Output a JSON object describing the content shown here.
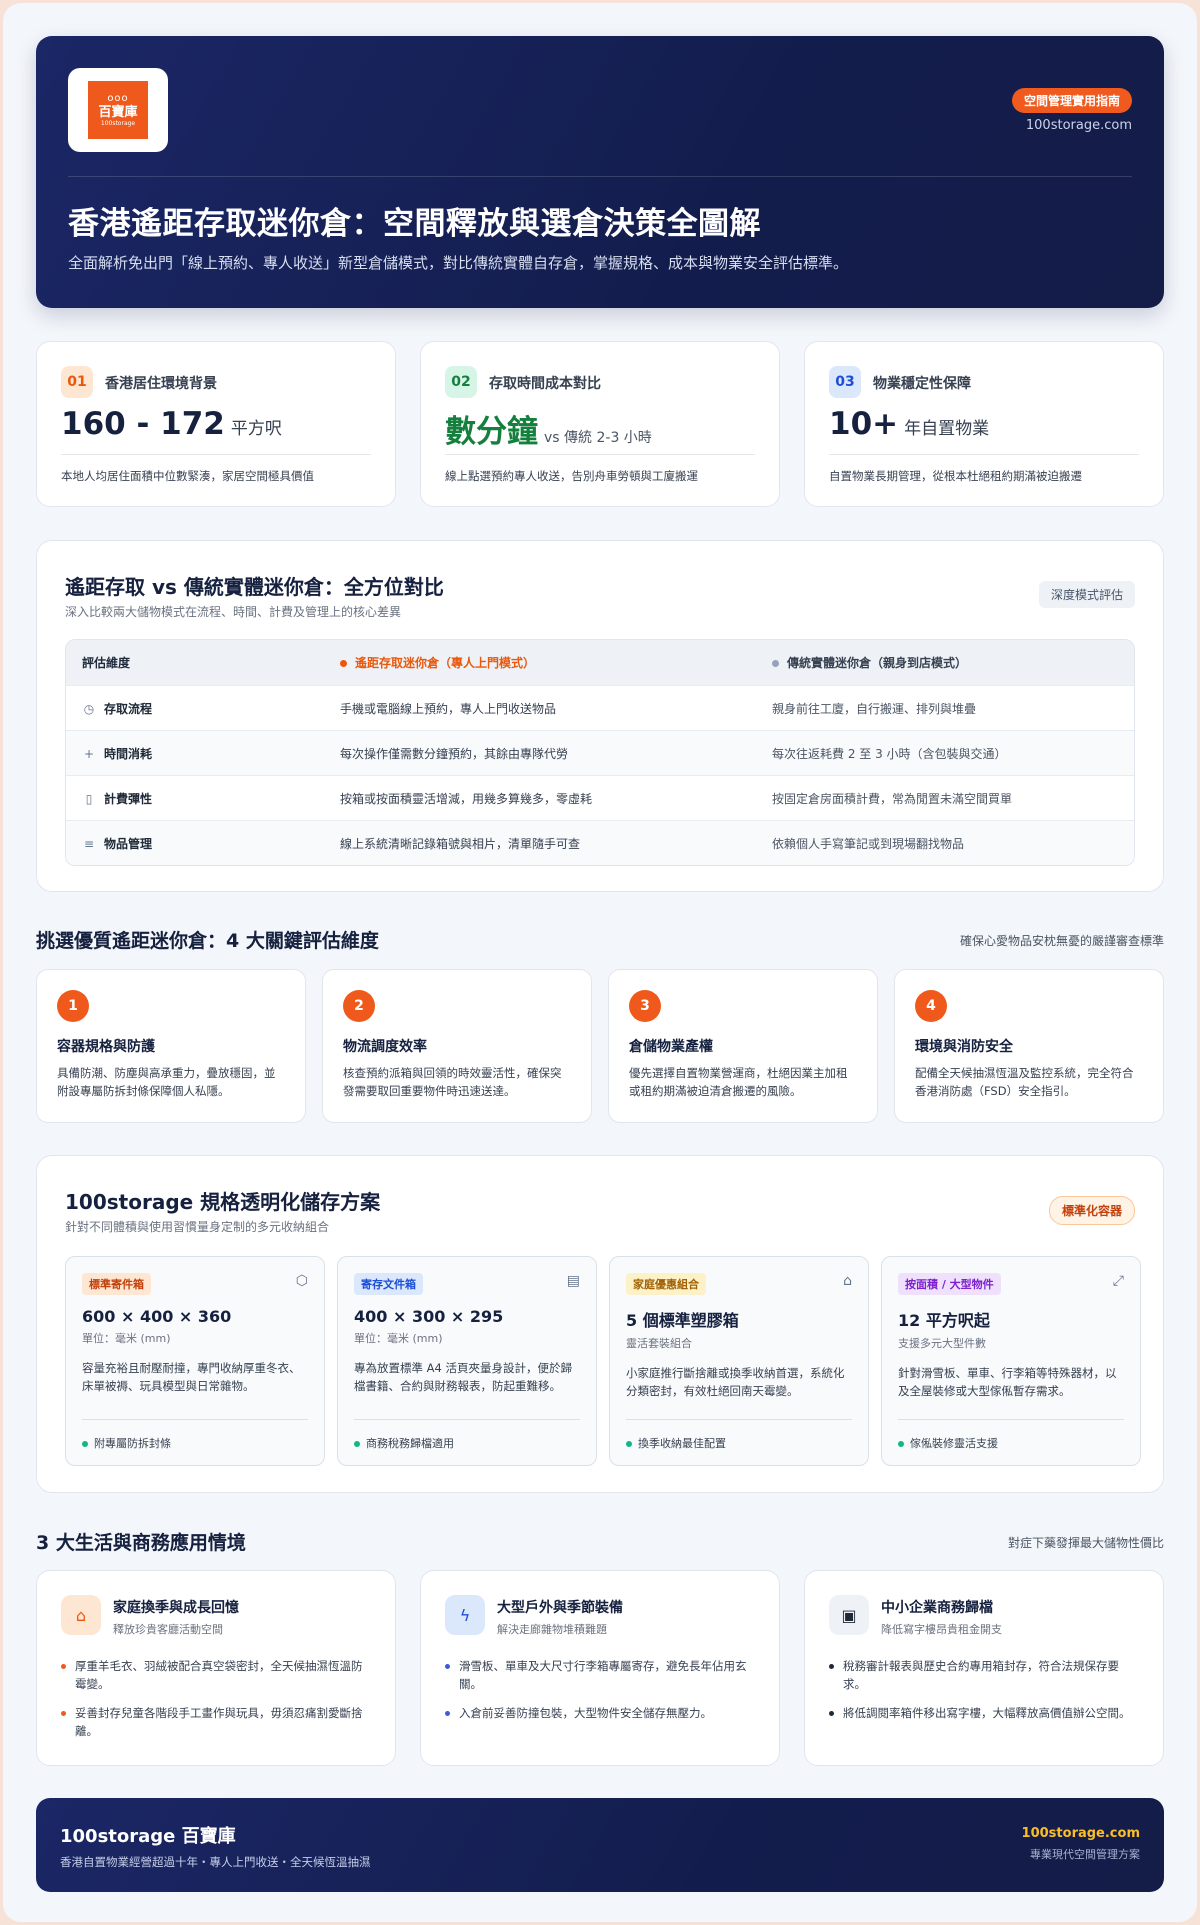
{
  "hero": {
    "logo": {
      "cn": "百寶庫",
      "en": "100storage",
      "dots": "ooo"
    },
    "badge": "空間管理實用指南",
    "site": "100storage.com",
    "title": "香港遙距存取迷你倉：空間釋放與選倉決策全圖解",
    "subtitle": "全面解析免出門「線上預約、專人收送」新型倉儲模式，對比傳統實體自存倉，掌握規格、成本與物業安全評估標準。"
  },
  "stats": [
    {
      "num": "01",
      "label": "香港居住環境背景",
      "value": "160 - 172",
      "unit": "平方呎",
      "note": "本地人均居住面積中位數緊湊，家居空間極具價值"
    },
    {
      "num": "02",
      "label": "存取時間成本對比",
      "value": "數分鐘",
      "unit": "vs 傳統 2-3 小時",
      "note": "線上點選預約專人收送，告別舟車勞頓與工廈搬運"
    },
    {
      "num": "03",
      "label": "物業穩定性保障",
      "value": "10+",
      "unit": "年自置物業",
      "note": "自置物業長期管理，從根本杜絕租約期滿被迫搬遷"
    }
  ],
  "compare": {
    "title": "遙距存取 vs 傳統實體迷你倉：全方位對比",
    "subtitle": "深入比較兩大儲物模式在流程、時間、計費及管理上的核心差異",
    "tag": "深度模式評估",
    "headers": [
      "評估維度",
      "遙距存取迷你倉（專人上門模式）",
      "傳統實體迷你倉（親身到店模式）"
    ],
    "rows": [
      {
        "icon": "clock-icon",
        "glyph": "◷",
        "dim": "存取流程",
        "remote": "手機或電腦線上預約，專人上門收送物品",
        "trad": "親身前往工廈，自行搬運、排列與堆疊"
      },
      {
        "icon": "plus-icon",
        "glyph": "+",
        "dim": "時間消耗",
        "remote": "每次操作僅需數分鐘預約，其餘由專隊代勞",
        "trad": "每次往返耗費 2 至 3 小時（含包裝與交通）"
      },
      {
        "icon": "calculator-icon",
        "glyph": "▯",
        "dim": "計費彈性",
        "remote": "按箱或按面積靈活增減，用幾多算幾多，零虛耗",
        "trad": "按固定倉房面積計費，常為閒置未滿空間買單"
      },
      {
        "icon": "list-icon",
        "glyph": "≡",
        "dim": "物品管理",
        "remote": "線上系統清晰記錄箱號與相片，清單隨手可查",
        "trad": "依賴個人手寫筆記或到現場翻找物品"
      }
    ]
  },
  "evalSection": {
    "title": "挑選優質遙距迷你倉：4 大關鍵評估維度",
    "right": "確保心愛物品安枕無憂的嚴謹審查標準",
    "items": [
      {
        "n": "1",
        "title": "容器規格與防護",
        "desc": "具備防潮、防塵與高承重力，疊放穩固，並附設專屬防拆封條保障個人私隱。"
      },
      {
        "n": "2",
        "title": "物流調度效率",
        "desc": "核查預約派箱與回領的時效靈活性，確保突發需要取回重要物件時迅速送達。"
      },
      {
        "n": "3",
        "title": "倉儲物業產權",
        "desc": "優先選擇自置物業營運商，杜絕因業主加租或租約期滿被迫清倉搬遷的風險。"
      },
      {
        "n": "4",
        "title": "環境與消防安全",
        "desc": "配備全天候抽濕恆溫及監控系統，完全符合香港消防處（FSD）安全指引。"
      }
    ]
  },
  "plans": {
    "title": "100storage 規格透明化儲存方案",
    "subtitle": "針對不同體積與使用習慣量身定制的多元收納組合",
    "tag": "標準化容器",
    "items": [
      {
        "tag": "標準寄件箱",
        "tagBg": "#fde7d3",
        "tagColor": "#c2410c",
        "icon": "box-icon",
        "glyph": "⬡",
        "spec": "600 × 400 × 360",
        "unit": "單位：毫米 (mm)",
        "desc": "容量充裕且耐壓耐撞，專門收納厚重冬衣、床單被褥、玩具模型與日常雜物。",
        "foot": "附專屬防拆封條"
      },
      {
        "tag": "寄存文件箱",
        "tagBg": "#dbe7fb",
        "tagColor": "#1d4ed8",
        "icon": "document-icon",
        "glyph": "▤",
        "spec": "400 × 300 × 295",
        "unit": "單位：毫米 (mm)",
        "desc": "專為放置標準 A4 活頁夾量身設計，便於歸檔書籍、合約與財務報表，防起重難移。",
        "foot": "商務稅務歸檔適用"
      },
      {
        "tag": "家庭優惠組合",
        "tagBg": "#fdf1c7",
        "tagColor": "#a16207",
        "icon": "bag-icon",
        "glyph": "⌂",
        "spec": "5 個標準塑膠箱",
        "unit": "靈活套裝組合",
        "desc": "小家庭推行斷捨離或換季收納首選，系統化分類密封，有效杜絕回南天霉變。",
        "foot": "換季收納最佳配置"
      },
      {
        "tag": "按面積 / 大型物件",
        "tagBg": "#efe1fb",
        "tagColor": "#7e22ce",
        "icon": "expand-icon",
        "glyph": "⤢",
        "spec": "12 平方呎起",
        "unit": "支援多元大型件數",
        "desc": "針對滑雪板、單車、行李箱等特殊器材，以及全屋裝修或大型傢俬暫存需求。",
        "foot": "傢俬裝修靈活支援"
      }
    ]
  },
  "scenSection": {
    "title": "3 大生活與商務應用情境",
    "right": "對症下藥發揮最大儲物性價比",
    "items": [
      {
        "icon": "home-icon",
        "glyph": "⌂",
        "bg": "#fde7d3",
        "color": "#ea580c",
        "title": "家庭換季與成長回憶",
        "sub": "釋放珍貴客廳活動空間",
        "points": [
          "厚重羊毛衣、羽絨被配合真空袋密封，全天候抽濕恆溫防霉變。",
          "妥善封存兒童各階段手工畫作與玩具，毋須忍痛割愛斷捨離。"
        ]
      },
      {
        "icon": "bolt-icon",
        "glyph": "ϟ",
        "bg": "#dbe7fb",
        "color": "#1d4ed8",
        "title": "大型戶外與季節裝備",
        "sub": "解決走廊雜物堆積難題",
        "points": [
          "滑雪板、單車及大尺寸行李箱專屬寄存，避免長年佔用玄關。",
          "入倉前妥善防撞包裝，大型物件安全儲存無壓力。"
        ]
      },
      {
        "icon": "briefcase-icon",
        "glyph": "▣",
        "bg": "#eef1f6",
        "color": "#1f2937",
        "title": "中小企業商務歸檔",
        "sub": "降低寫字樓昂貴租金開支",
        "points": [
          "稅務審計報表與歷史合約專用箱封存，符合法規保存要求。",
          "將低調閱率箱件移出寫字樓，大幅釋放高價值辦公空間。"
        ]
      }
    ]
  },
  "footer": {
    "title": "100storage 百寶庫",
    "sub": "香港自置物業經營超過十年・專人上門收送・全天候恆溫抽濕",
    "site": "100storage.com",
    "slogan": "專業現代空間管理方案"
  }
}
